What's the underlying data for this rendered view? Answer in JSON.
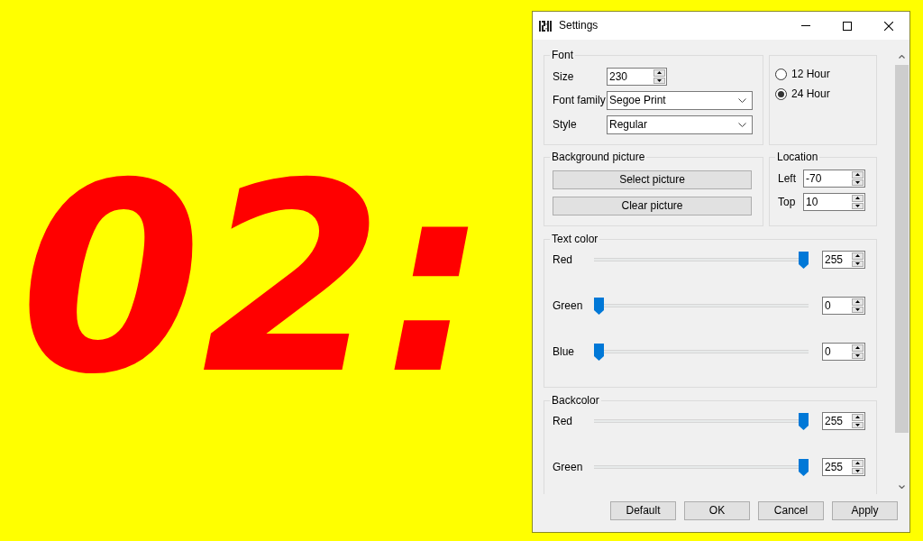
{
  "window": {
    "title": "Settings"
  },
  "clock": {
    "text": "02:"
  },
  "font": {
    "legend": "Font",
    "fields": [
      {
        "kind": "spinner",
        "label": "Size",
        "value": "230"
      },
      {
        "kind": "dropdown",
        "label": "Font family",
        "value": "Segoe Print"
      },
      {
        "kind": "dropdown",
        "label": "Style",
        "value": "Regular"
      }
    ]
  },
  "hour_format": [
    {
      "label": "12 Hour",
      "selected": false
    },
    {
      "label": "24 Hour",
      "selected": true
    }
  ],
  "background_picture": {
    "legend": "Background picture",
    "buttons": [
      "Select picture",
      "Clear picture"
    ]
  },
  "location": {
    "legend": "Location",
    "fields": [
      {
        "label": "Left",
        "value": "-70"
      },
      {
        "label": "Top",
        "value": "10"
      }
    ]
  },
  "text_color": {
    "legend": "Text color",
    "channels": [
      {
        "name": "Red",
        "level": 1,
        "value": "255"
      },
      {
        "name": "Green",
        "level": 0,
        "value": "0"
      },
      {
        "name": "Blue",
        "level": 0,
        "value": "0"
      }
    ]
  },
  "backcolor": {
    "legend": "Backcolor",
    "channels": [
      {
        "name": "Red",
        "level": 1,
        "value": "255"
      },
      {
        "name": "Green",
        "level": 1,
        "value": "255"
      }
    ]
  },
  "buttons": [
    "Default",
    "OK",
    "Cancel",
    "Apply"
  ]
}
